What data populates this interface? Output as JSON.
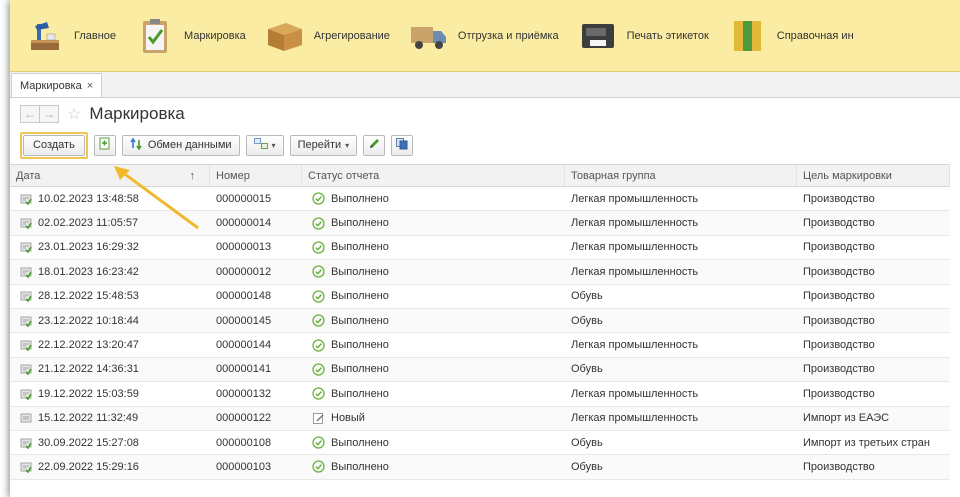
{
  "sections": [
    {
      "label": "Главное",
      "icon": "desk-lamp-icon"
    },
    {
      "label": "Маркировка",
      "icon": "clipboard-check-icon"
    },
    {
      "label": "Агрегирование",
      "icon": "box-icon"
    },
    {
      "label": "Отгрузка и приёмка",
      "icon": "truck-icon"
    },
    {
      "label": "Печать этикеток",
      "icon": "label-printer-icon"
    },
    {
      "label": "Справочная ин",
      "icon": "binders-icon"
    }
  ],
  "tab": {
    "label": "Маркировка",
    "close": "×"
  },
  "page": {
    "title": "Маркировка",
    "back": "←",
    "forward": "→",
    "star": "☆"
  },
  "toolbar": {
    "create_label": "Создать",
    "exchange_label": "Обмен данными",
    "goto_label": "Перейти",
    "dropdown_glyph": "▾"
  },
  "table": {
    "columns": [
      "Дата",
      "Номер",
      "Статус отчета",
      "Товарная группа",
      "Цель маркировки"
    ],
    "sort_indicator": "↑",
    "rows": [
      {
        "date": "10.02.2023 13:48:58",
        "number": "000000015",
        "status": "Выполнено",
        "status_kind": "done",
        "group": "Легкая промышленность",
        "purpose": "Производство"
      },
      {
        "date": "02.02.2023 11:05:57",
        "number": "000000014",
        "status": "Выполнено",
        "status_kind": "done",
        "group": "Легкая промышленность",
        "purpose": "Производство"
      },
      {
        "date": "23.01.2023 16:29:32",
        "number": "000000013",
        "status": "Выполнено",
        "status_kind": "done",
        "group": "Легкая промышленность",
        "purpose": "Производство"
      },
      {
        "date": "18.01.2023 16:23:42",
        "number": "000000012",
        "status": "Выполнено",
        "status_kind": "done",
        "group": "Легкая промышленность",
        "purpose": "Производство"
      },
      {
        "date": "28.12.2022 15:48:53",
        "number": "000000148",
        "status": "Выполнено",
        "status_kind": "done",
        "group": "Обувь",
        "purpose": "Производство"
      },
      {
        "date": "23.12.2022 10:18:44",
        "number": "000000145",
        "status": "Выполнено",
        "status_kind": "done",
        "group": "Обувь",
        "purpose": "Производство"
      },
      {
        "date": "22.12.2022 13:20:47",
        "number": "000000144",
        "status": "Выполнено",
        "status_kind": "done",
        "group": "Легкая промышленность",
        "purpose": "Производство"
      },
      {
        "date": "21.12.2022 14:36:31",
        "number": "000000141",
        "status": "Выполнено",
        "status_kind": "done",
        "group": "Обувь",
        "purpose": "Производство"
      },
      {
        "date": "19.12.2022 15:03:59",
        "number": "000000132",
        "status": "Выполнено",
        "status_kind": "done",
        "group": "Легкая промышленность",
        "purpose": "Производство"
      },
      {
        "date": "15.12.2022 11:32:49",
        "number": "000000122",
        "status": "Новый",
        "status_kind": "new",
        "group": "Легкая промышленность",
        "purpose": "Импорт из ЕАЭС"
      },
      {
        "date": "30.09.2022 15:27:08",
        "number": "000000108",
        "status": "Выполнено",
        "status_kind": "done",
        "group": "Обувь",
        "purpose": "Импорт из третьих стран"
      },
      {
        "date": "22.09.2022 15:29:16",
        "number": "000000103",
        "status": "Выполнено",
        "status_kind": "done",
        "group": "Обувь",
        "purpose": "Производство"
      }
    ]
  },
  "colors": {
    "section_bar": "#fbeca4",
    "highlight": "#f0c650",
    "status_done": "#6cb33e"
  }
}
